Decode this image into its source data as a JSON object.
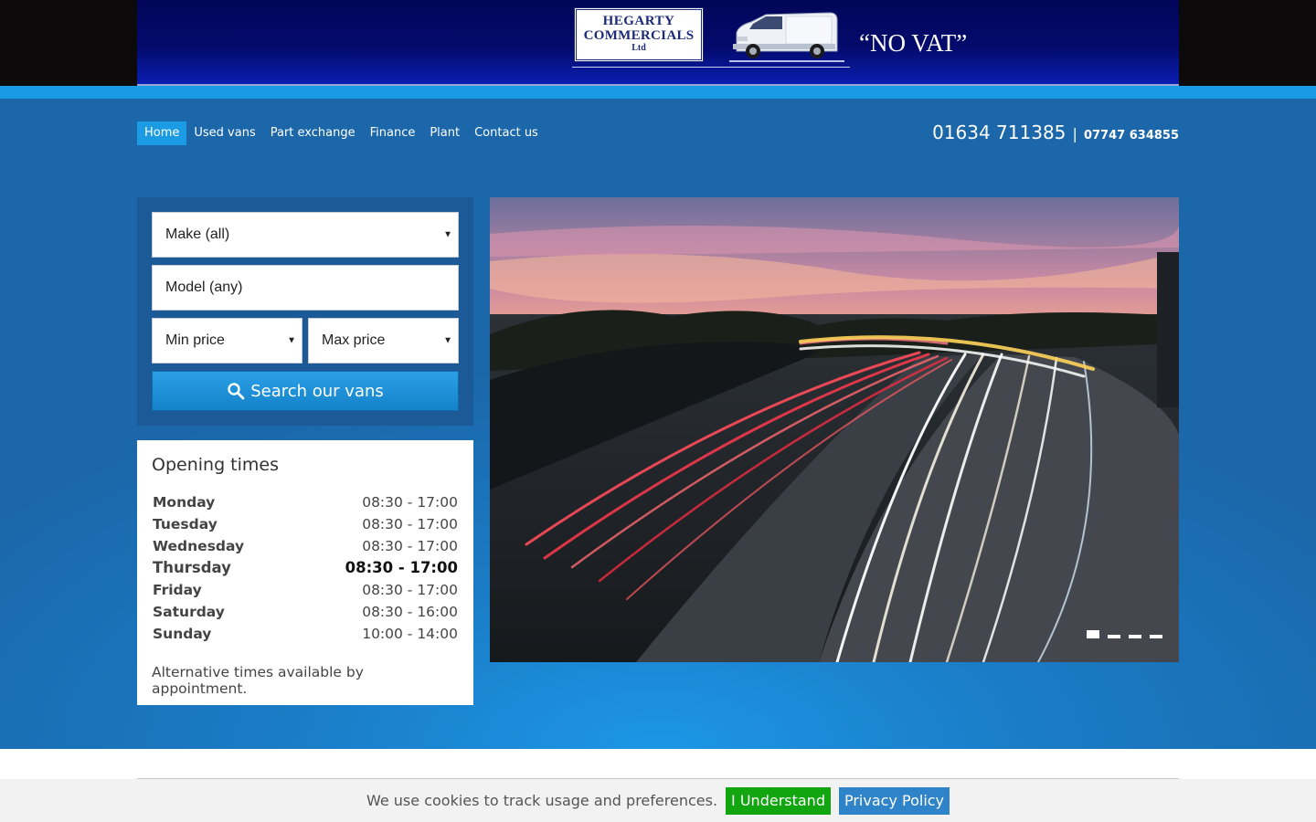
{
  "header": {
    "logo": {
      "line1": "HEGARTY",
      "line2": "COMMERCIALS",
      "line3": "Ltd"
    },
    "tagline": "“NO VAT”"
  },
  "nav": {
    "items": [
      {
        "label": "Home",
        "active": true
      },
      {
        "label": "Used vans",
        "active": false
      },
      {
        "label": "Part exchange",
        "active": false
      },
      {
        "label": "Finance",
        "active": false
      },
      {
        "label": "Plant",
        "active": false
      },
      {
        "label": "Contact us",
        "active": false
      }
    ]
  },
  "contact": {
    "phone_main": "01634 711385",
    "separator": "|",
    "phone_alt": "07747 634855"
  },
  "search": {
    "make_value": "Make (all)",
    "model_placeholder": "Model (any)",
    "min_price_value": "Min price",
    "max_price_value": "Max price",
    "button_label": "Search our vans"
  },
  "opening_times": {
    "title": "Opening times",
    "rows": [
      {
        "day": "Monday",
        "hours": "08:30 - 17:00"
      },
      {
        "day": "Tuesday",
        "hours": "08:30 - 17:00"
      },
      {
        "day": "Wednesday",
        "hours": "08:30 - 17:00"
      },
      {
        "day": "Thursday",
        "hours": "08:30 - 17:00"
      },
      {
        "day": "Friday",
        "hours": "08:30 - 17:00"
      },
      {
        "day": "Saturday",
        "hours": "08:30 - 16:00"
      },
      {
        "day": "Sunday",
        "hours": "10:00 - 14:00"
      }
    ],
    "highlighted_day": "Thursday",
    "note": "Alternative times available by appointment."
  },
  "slider": {
    "slide_count": 4,
    "active_index": 0
  },
  "cookie": {
    "text": "We use cookies to track usage and preferences.",
    "accept_label": "I Understand",
    "policy_label": "Privacy Policy"
  },
  "colors": {
    "banner": "#030a6b",
    "accent_strip": "#1a9ae2",
    "hero_blue": "#1a7cc6",
    "panel_blue": "#1b5a97",
    "nav_active": "#1b9be3",
    "accept_green": "#11a50f",
    "policy_blue": "#2f83c9"
  },
  "icons": {
    "search_button": "search-icon",
    "select_caret": "caret-down-icon"
  }
}
